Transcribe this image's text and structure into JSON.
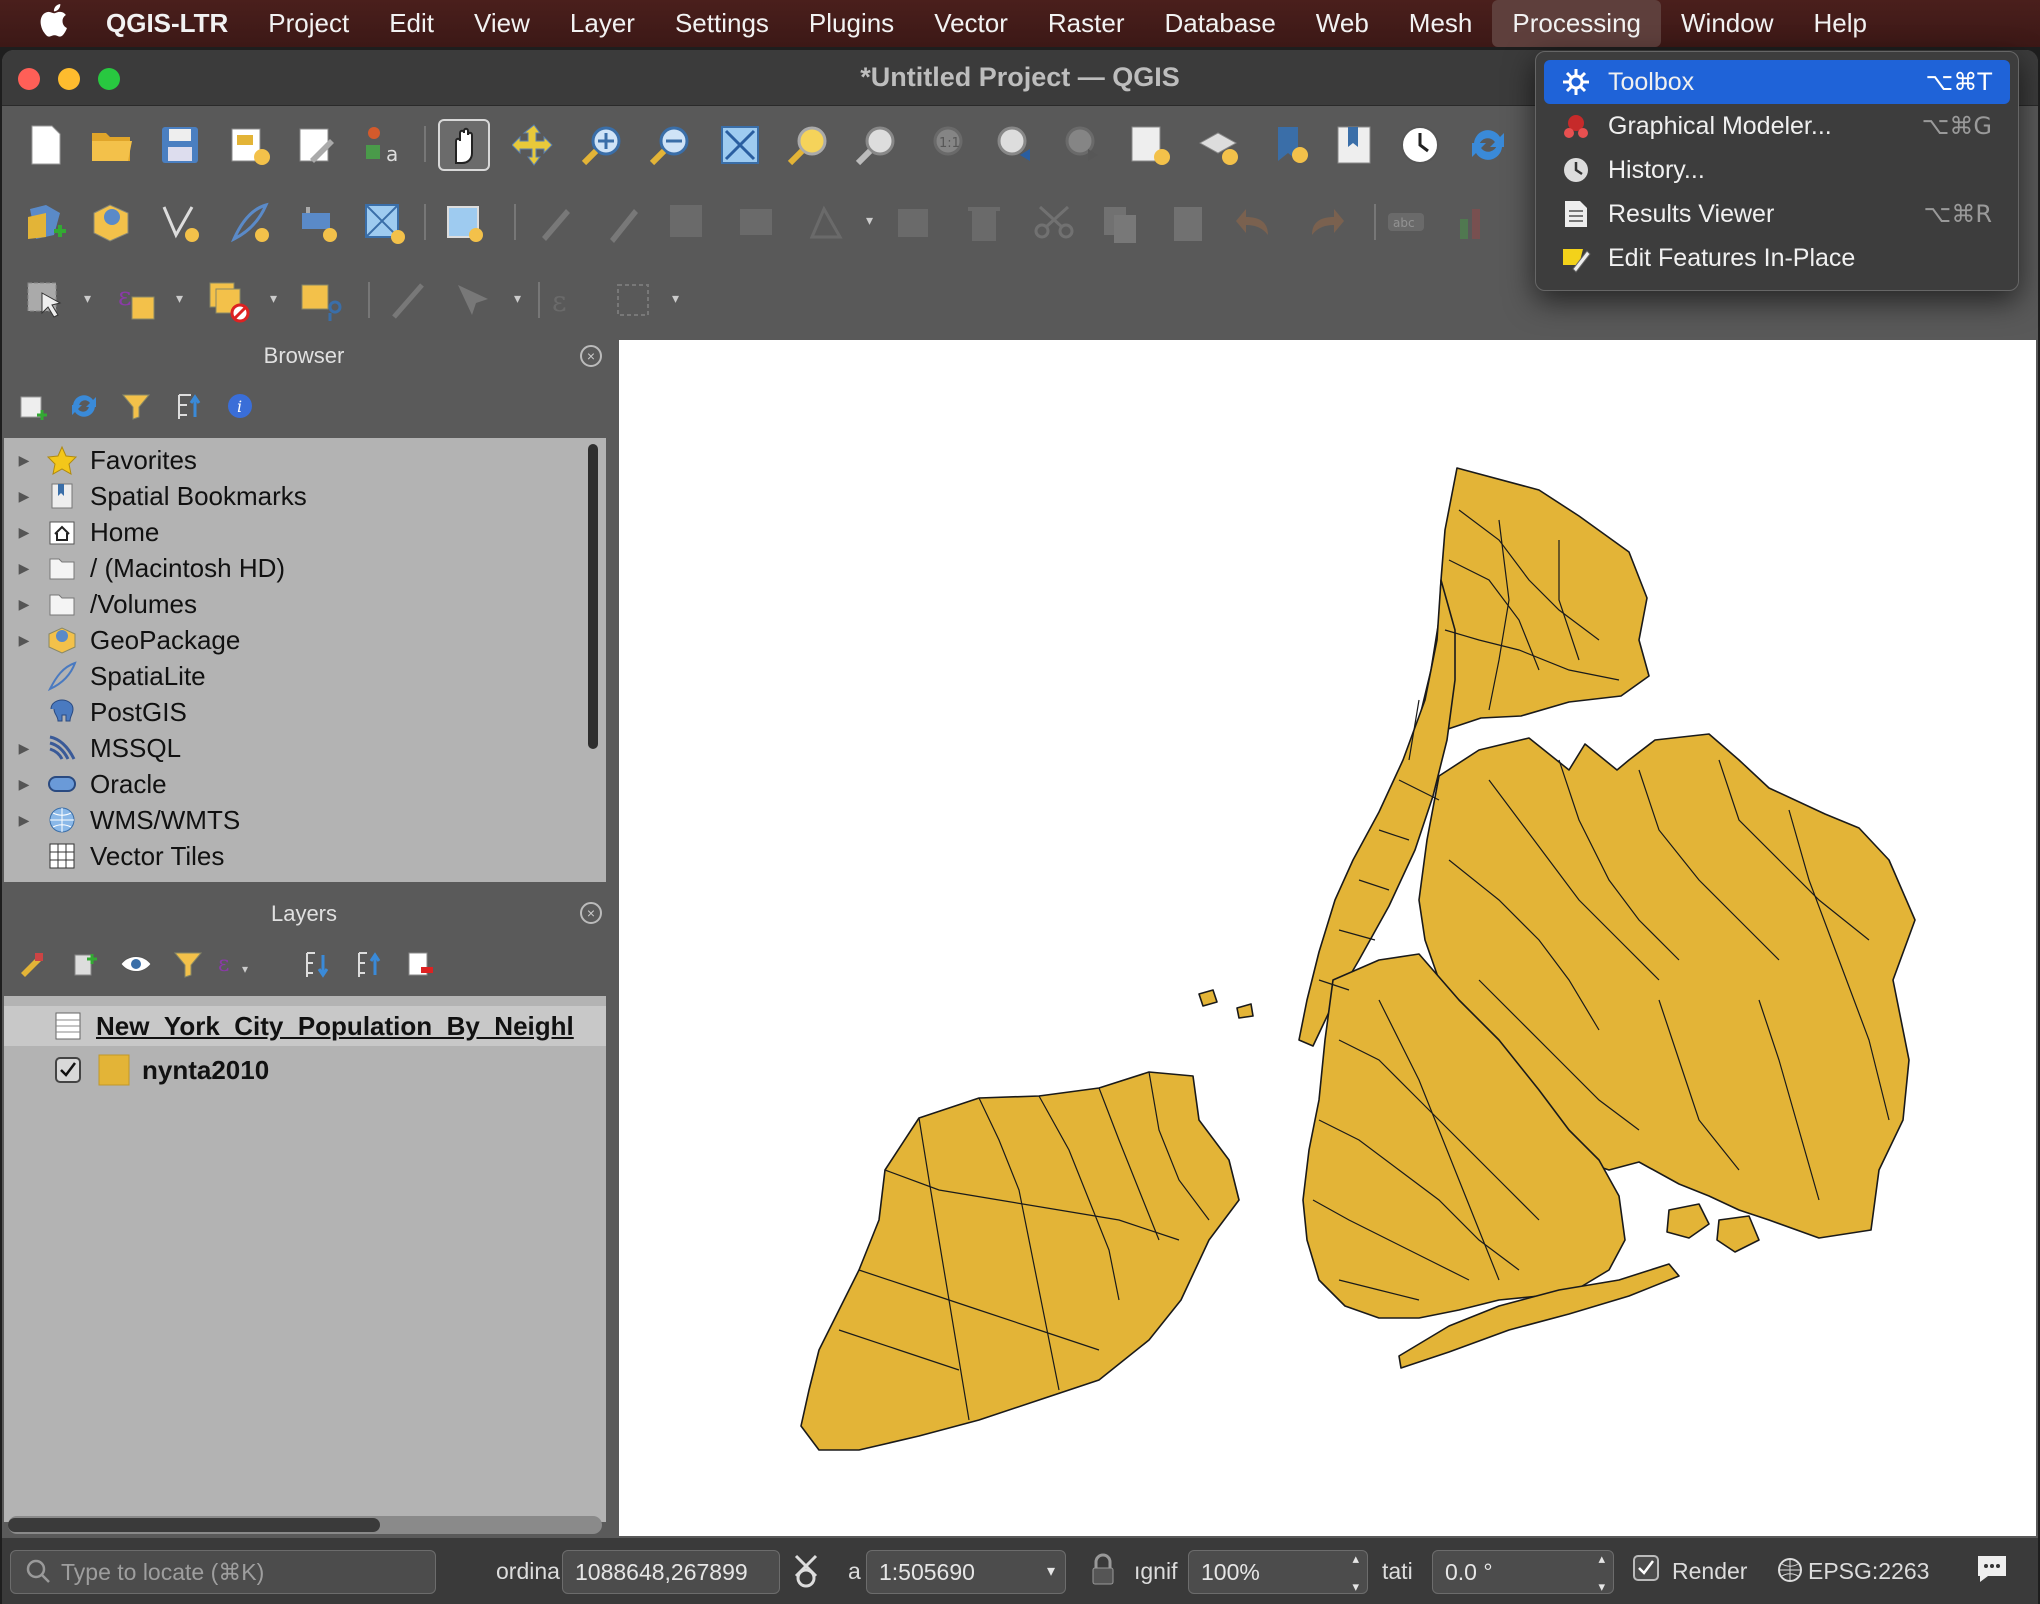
{
  "menubar": {
    "app_name": "QGIS-LTR",
    "items": [
      "Project",
      "Edit",
      "View",
      "Layer",
      "Settings",
      "Plugins",
      "Vector",
      "Raster",
      "Database",
      "Web",
      "Mesh",
      "Processing",
      "Window",
      "Help"
    ],
    "active_item": "Processing"
  },
  "window": {
    "title": "*Untitled Project — QGIS"
  },
  "processing_menu": {
    "items": [
      {
        "label": "Toolbox",
        "shortcut": "⌥⌘T",
        "icon": "gear-icon",
        "highlighted": true
      },
      {
        "label": "Graphical Modeler...",
        "shortcut": "⌥⌘G",
        "icon": "modeler-icon",
        "highlighted": false
      },
      {
        "label": "History...",
        "shortcut": "",
        "icon": "clock-icon",
        "highlighted": false
      },
      {
        "label": "Results Viewer",
        "shortcut": "⌥⌘R",
        "icon": "document-icon",
        "highlighted": false
      },
      {
        "label": "Edit Features In-Place",
        "shortcut": "",
        "icon": "edit-in-place-icon",
        "highlighted": false
      }
    ]
  },
  "browser": {
    "title": "Browser",
    "items": [
      {
        "label": "Favorites",
        "icon": "star-icon",
        "expandable": true
      },
      {
        "label": "Spatial Bookmarks",
        "icon": "bookmark-icon",
        "expandable": true
      },
      {
        "label": "Home",
        "icon": "home-icon",
        "expandable": true
      },
      {
        "label": "/ (Macintosh HD)",
        "icon": "folder-icon",
        "expandable": true
      },
      {
        "label": "/Volumes",
        "icon": "folder-icon",
        "expandable": true
      },
      {
        "label": "GeoPackage",
        "icon": "geopackage-icon",
        "expandable": true
      },
      {
        "label": "SpatiaLite",
        "icon": "feather-icon",
        "expandable": false
      },
      {
        "label": "PostGIS",
        "icon": "elephant-icon",
        "expandable": false
      },
      {
        "label": "MSSQL",
        "icon": "mssql-icon",
        "expandable": true
      },
      {
        "label": "Oracle",
        "icon": "oracle-icon",
        "expandable": true
      },
      {
        "label": "WMS/WMTS",
        "icon": "globe-icon",
        "expandable": true
      },
      {
        "label": "Vector Tiles",
        "icon": "grid-icon",
        "expandable": false
      }
    ]
  },
  "layers": {
    "title": "Layers",
    "items": [
      {
        "label": "New_York_City_Population_By_Neighl",
        "type": "table",
        "checked": null
      },
      {
        "label": "nynta2010",
        "type": "polygon",
        "checked": true,
        "swatch_color": "#e3b437"
      }
    ]
  },
  "statusbar": {
    "locate_placeholder": "Type to locate (⌘K)",
    "coordinate_label": "ordina",
    "coordinate_value": "1088648,267899",
    "scale_label": "a",
    "scale_value": "1:505690",
    "magnifier_label": "ıgnif",
    "magnifier_value": "100%",
    "rotation_label": "tati",
    "rotation_value": "0.0 °",
    "render_label": "Render",
    "render_checked": true,
    "crs": "EPSG:2263"
  },
  "map": {
    "fill_color": "#e3b437",
    "stroke_color": "#1a1a1a",
    "background": "#ffffff"
  }
}
